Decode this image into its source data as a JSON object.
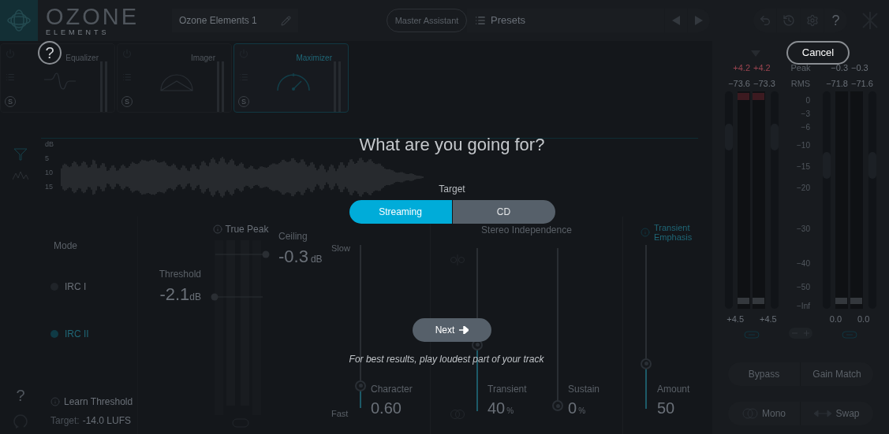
{
  "header": {
    "logo": "OZONE",
    "edition": "ELEMENTS",
    "preset_name": "Ozone Elements 1",
    "master_assistant": "Master Assistant",
    "presets": "Presets",
    "help": "?"
  },
  "modules": [
    {
      "name": "Equalizer",
      "kind": "eq",
      "selected": false,
      "solo": "S"
    },
    {
      "name": "Imager",
      "kind": "imager",
      "selected": false,
      "solo": "S"
    },
    {
      "name": "Maximizer",
      "kind": "maximizer",
      "selected": true,
      "solo": "S"
    }
  ],
  "waveform": {
    "axis_labels": [
      "dB",
      "5",
      "10",
      "15"
    ]
  },
  "sidebar": {
    "help": "?"
  },
  "mode": {
    "label": "Mode",
    "options": [
      {
        "label": "IRC I",
        "selected": false
      },
      {
        "label": "IRC II",
        "selected": true
      }
    ],
    "learn": "Learn Threshold",
    "target_label": "Target:",
    "target_value": "-14.0 LUFS"
  },
  "threshold": {
    "label": "Threshold",
    "value": "-2.1",
    "unit": "dB"
  },
  "true_peak": "True Peak",
  "ceiling": {
    "label": "Ceiling",
    "value": "-0.3",
    "unit": "dB"
  },
  "character": {
    "slow": "Slow",
    "fast": "Fast",
    "label": "Character",
    "value": "0.60",
    "level": 0.11
  },
  "stereo": {
    "title": "Stereo Independence",
    "transient": {
      "label": "Transient",
      "value": "40",
      "unit": "%",
      "level": 0.4
    },
    "sustain": {
      "label": "Sustain",
      "value": "0",
      "unit": "%",
      "level": 0
    }
  },
  "transient_emphasis": {
    "title": "Transient Emphasis",
    "label": "Amount",
    "value": "50",
    "level": 0.26
  },
  "meters": {
    "peak_label": "Peak",
    "rms_label": "RMS",
    "input": {
      "peak": [
        "+4.2",
        "+4.2"
      ],
      "rms": [
        "−73.6",
        "−73.3"
      ],
      "gain": [
        "+4.5",
        "+4.5"
      ],
      "level": 0.79
    },
    "output": {
      "peak": [
        "−0.3",
        "−0.3"
      ],
      "rms": [
        "−71.8",
        "−71.6"
      ],
      "gain": [
        "0.0",
        "0.0"
      ],
      "level": 0.66
    },
    "scale": [
      "0",
      "−3",
      "−6",
      "−10",
      "−15",
      "−20",
      "−30",
      "−40",
      "−50",
      "−Inf"
    ],
    "bypass": "Bypass",
    "gain_match": "Gain Match",
    "mono": "Mono",
    "swap": "Swap"
  },
  "overlay": {
    "help": "?",
    "cancel": "Cancel",
    "title": "What are you going for?",
    "target_label": "Target",
    "options": [
      {
        "label": "Streaming",
        "selected": true
      },
      {
        "label": "CD",
        "selected": false
      }
    ],
    "next": "Next",
    "hint": "For best results, play loudest part of your track"
  }
}
